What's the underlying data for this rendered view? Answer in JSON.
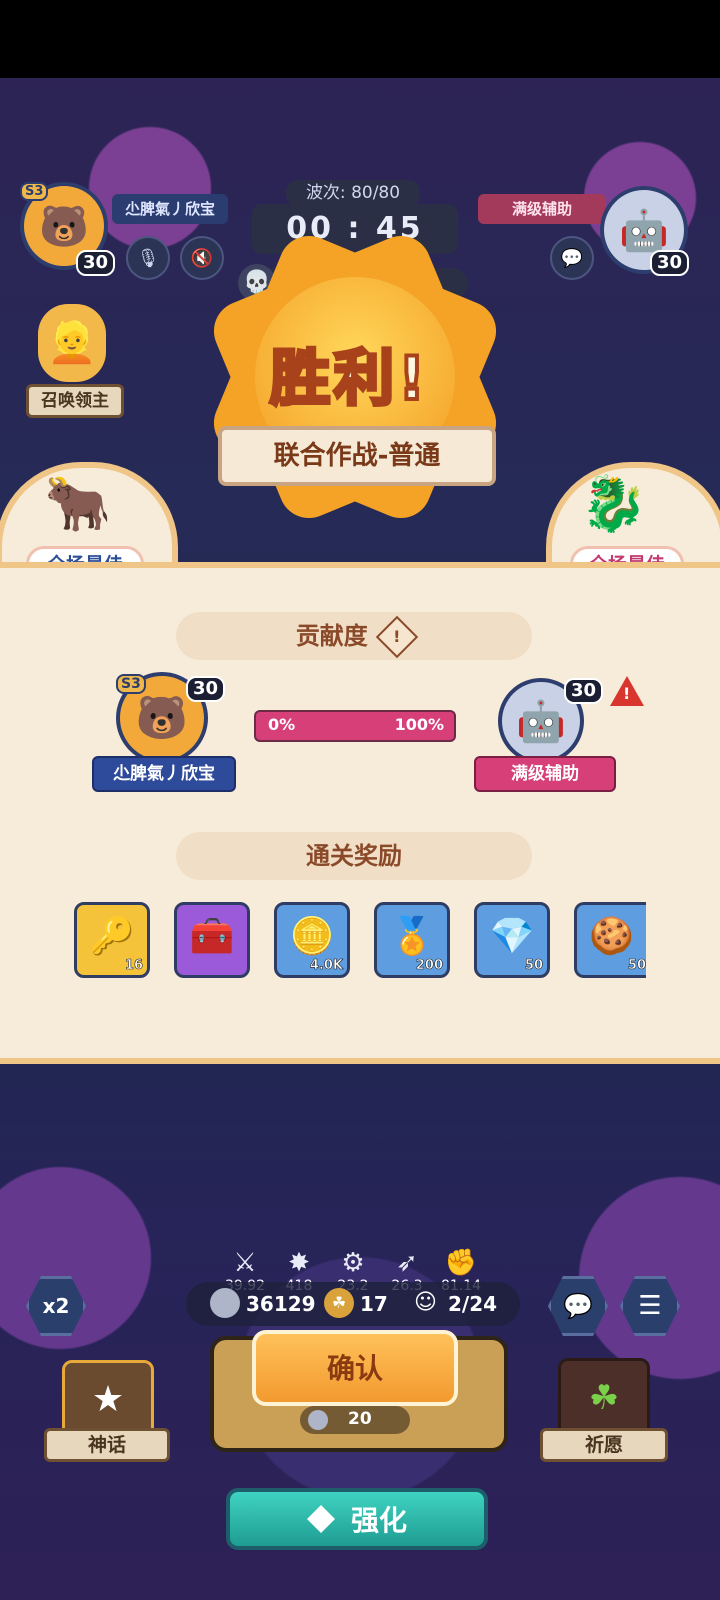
{
  "hud": {
    "player_name": "尐脾氣丿欣宝",
    "player_level": "30",
    "player_season": "S3",
    "wave_label": "波次: 80/80",
    "timer": "00 : 45",
    "ally_name": "满级辅助",
    "ally_level": "30",
    "summon_label": "召唤领主"
  },
  "victory": {
    "title": "胜利!",
    "mode": "联合作战-普通",
    "mvp_left": "全场最佳",
    "mvp_right": "全场最佳"
  },
  "contribution": {
    "heading": "贡献度",
    "player_name": "尐脾氣丿欣宝",
    "player_level": "30",
    "player_season": "S3",
    "ally_name": "满级辅助",
    "ally_level": "30",
    "left_percent": "0%",
    "right_percent": "100%",
    "ally_share": 1.0
  },
  "rewards": {
    "heading": "通关奖励",
    "items": [
      {
        "icon": "golden-key-icon",
        "amount": "16"
      },
      {
        "icon": "treasure-chest-icon",
        "amount": ""
      },
      {
        "icon": "gold-coin-icon",
        "amount": "4.0K"
      },
      {
        "icon": "trophy-medal-icon",
        "amount": "200"
      },
      {
        "icon": "purple-crystal-icon",
        "amount": "50"
      },
      {
        "icon": "cookie-icon",
        "amount": "50"
      }
    ]
  },
  "stats": [
    "39.92",
    "418",
    "23.2",
    "26.3",
    "81.14"
  ],
  "resources": {
    "coins": "36129",
    "clover": "17",
    "units": "2/24"
  },
  "speed_label": "x2",
  "confirm_label": "确认",
  "confirm_cost": "20",
  "upgrade_label": "强化",
  "myth_label": "神话",
  "pray_label": "祈愿",
  "colors": {
    "panel_bg": "#f7ecd9",
    "player_plate": "#2e4a9a",
    "ally_plate": "#d63f78",
    "confirm": "#f29a2f",
    "upgrade": "#2bb7a9"
  }
}
